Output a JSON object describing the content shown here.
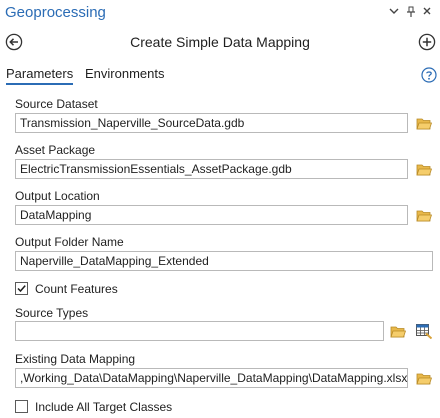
{
  "pane": {
    "title": "Geoprocessing",
    "menu_icon": "chevron-down-icon",
    "pin_icon": "pin-icon",
    "close_icon": "close-icon"
  },
  "tool": {
    "title": "Create Simple Data Mapping",
    "back_icon": "back-arrow-icon",
    "add_icon": "add-icon"
  },
  "tabs": [
    {
      "label": "Parameters",
      "active": true
    },
    {
      "label": "Environments",
      "active": false
    }
  ],
  "help_icon": "help-icon",
  "params": {
    "source_dataset": {
      "label": "Source Dataset",
      "value": "Transmission_Naperville_SourceData.gdb"
    },
    "asset_package": {
      "label": "Asset Package",
      "value": "ElectricTransmissionEssentials_AssetPackage.gdb"
    },
    "output_location": {
      "label": "Output Location",
      "value": "DataMapping"
    },
    "output_folder_name": {
      "label": "Output Folder Name",
      "value": "Naperville_DataMapping_Extended"
    },
    "count_features": {
      "label": "Count Features",
      "checked": true
    },
    "source_types": {
      "label": "Source Types",
      "value": ""
    },
    "existing_data_mapping": {
      "label": "Existing Data Mapping",
      "value": ",Working_Data\\DataMapping\\Naperville_DataMapping\\DataMapping.xlsx"
    },
    "include_all_target_classes": {
      "label": "Include All Target Classes",
      "checked": false
    }
  },
  "colors": {
    "accent": "#2b6cb5",
    "folder": "#e8b84a",
    "input_border": "#b9b9b9"
  }
}
